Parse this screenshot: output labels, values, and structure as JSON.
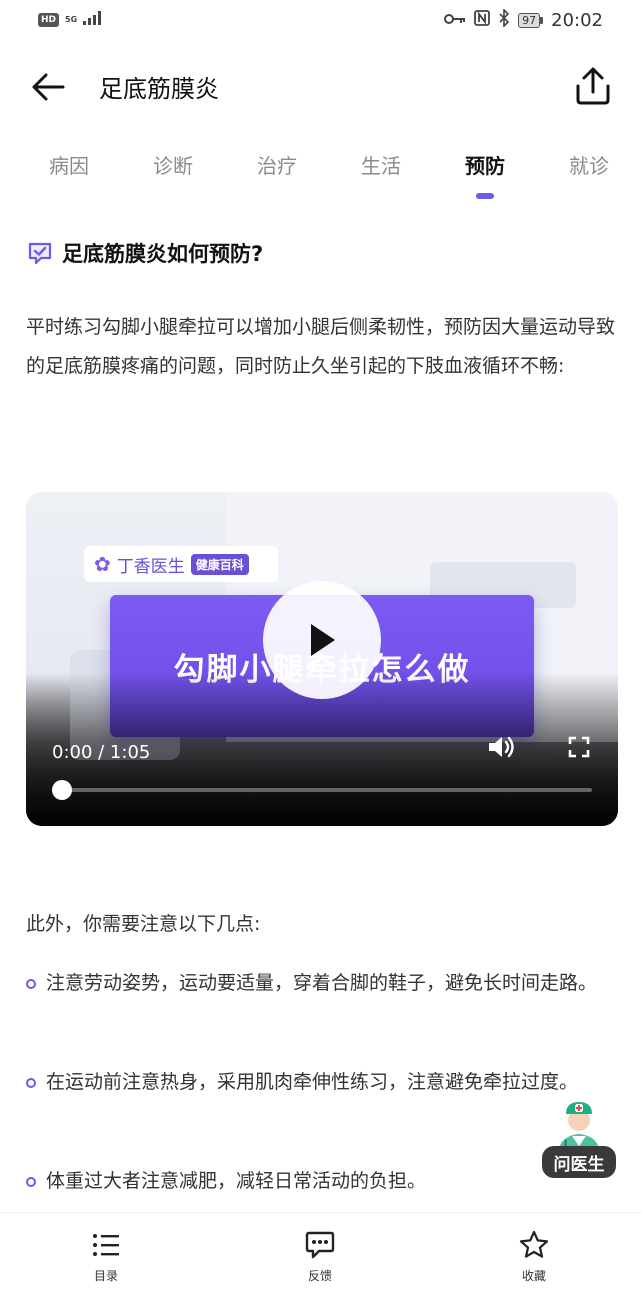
{
  "status_bar": {
    "hd": "HD",
    "network": "5G",
    "battery": "97",
    "time": "20:02"
  },
  "header": {
    "title": "足底筋膜炎"
  },
  "tabs": [
    {
      "label": "病因"
    },
    {
      "label": "诊断"
    },
    {
      "label": "治疗"
    },
    {
      "label": "生活"
    },
    {
      "label": "预防"
    },
    {
      "label": "就诊"
    }
  ],
  "active_tab": "预防",
  "section": {
    "heading": "足底筋膜炎如何预防?",
    "intro": "平时练习勾脚小腿牵拉可以增加小腿后侧柔韧性，预防因大量运动导致的足底筋膜疼痛的问题，同时防止久坐引起的下肢血液循环不畅:",
    "outro": "此外，你需要注意以下几点:",
    "bullets": [
      "注意劳动姿势，运动要适量，穿着合脚的鞋子，避免长时间走路。",
      "在运动前注意热身，采用肌肉牵伸性练习，注意避免牵拉过度。",
      "体重过大者注意减肥，减轻日常活动的负担。"
    ]
  },
  "video": {
    "brand_name": "丁香医生",
    "brand_tag": "健康百科",
    "banner_title": "勾脚小腿牵拉怎么做",
    "time_display": "0:00 / 1:05",
    "progress": 0
  },
  "doctor_fab": {
    "label": "问医生"
  },
  "bottom_bar": {
    "items": [
      {
        "label": "目录"
      },
      {
        "label": "反馈"
      },
      {
        "label": "收藏"
      }
    ]
  },
  "colors": {
    "accent": "#6b5ce7",
    "banner": "#6a49e4"
  }
}
